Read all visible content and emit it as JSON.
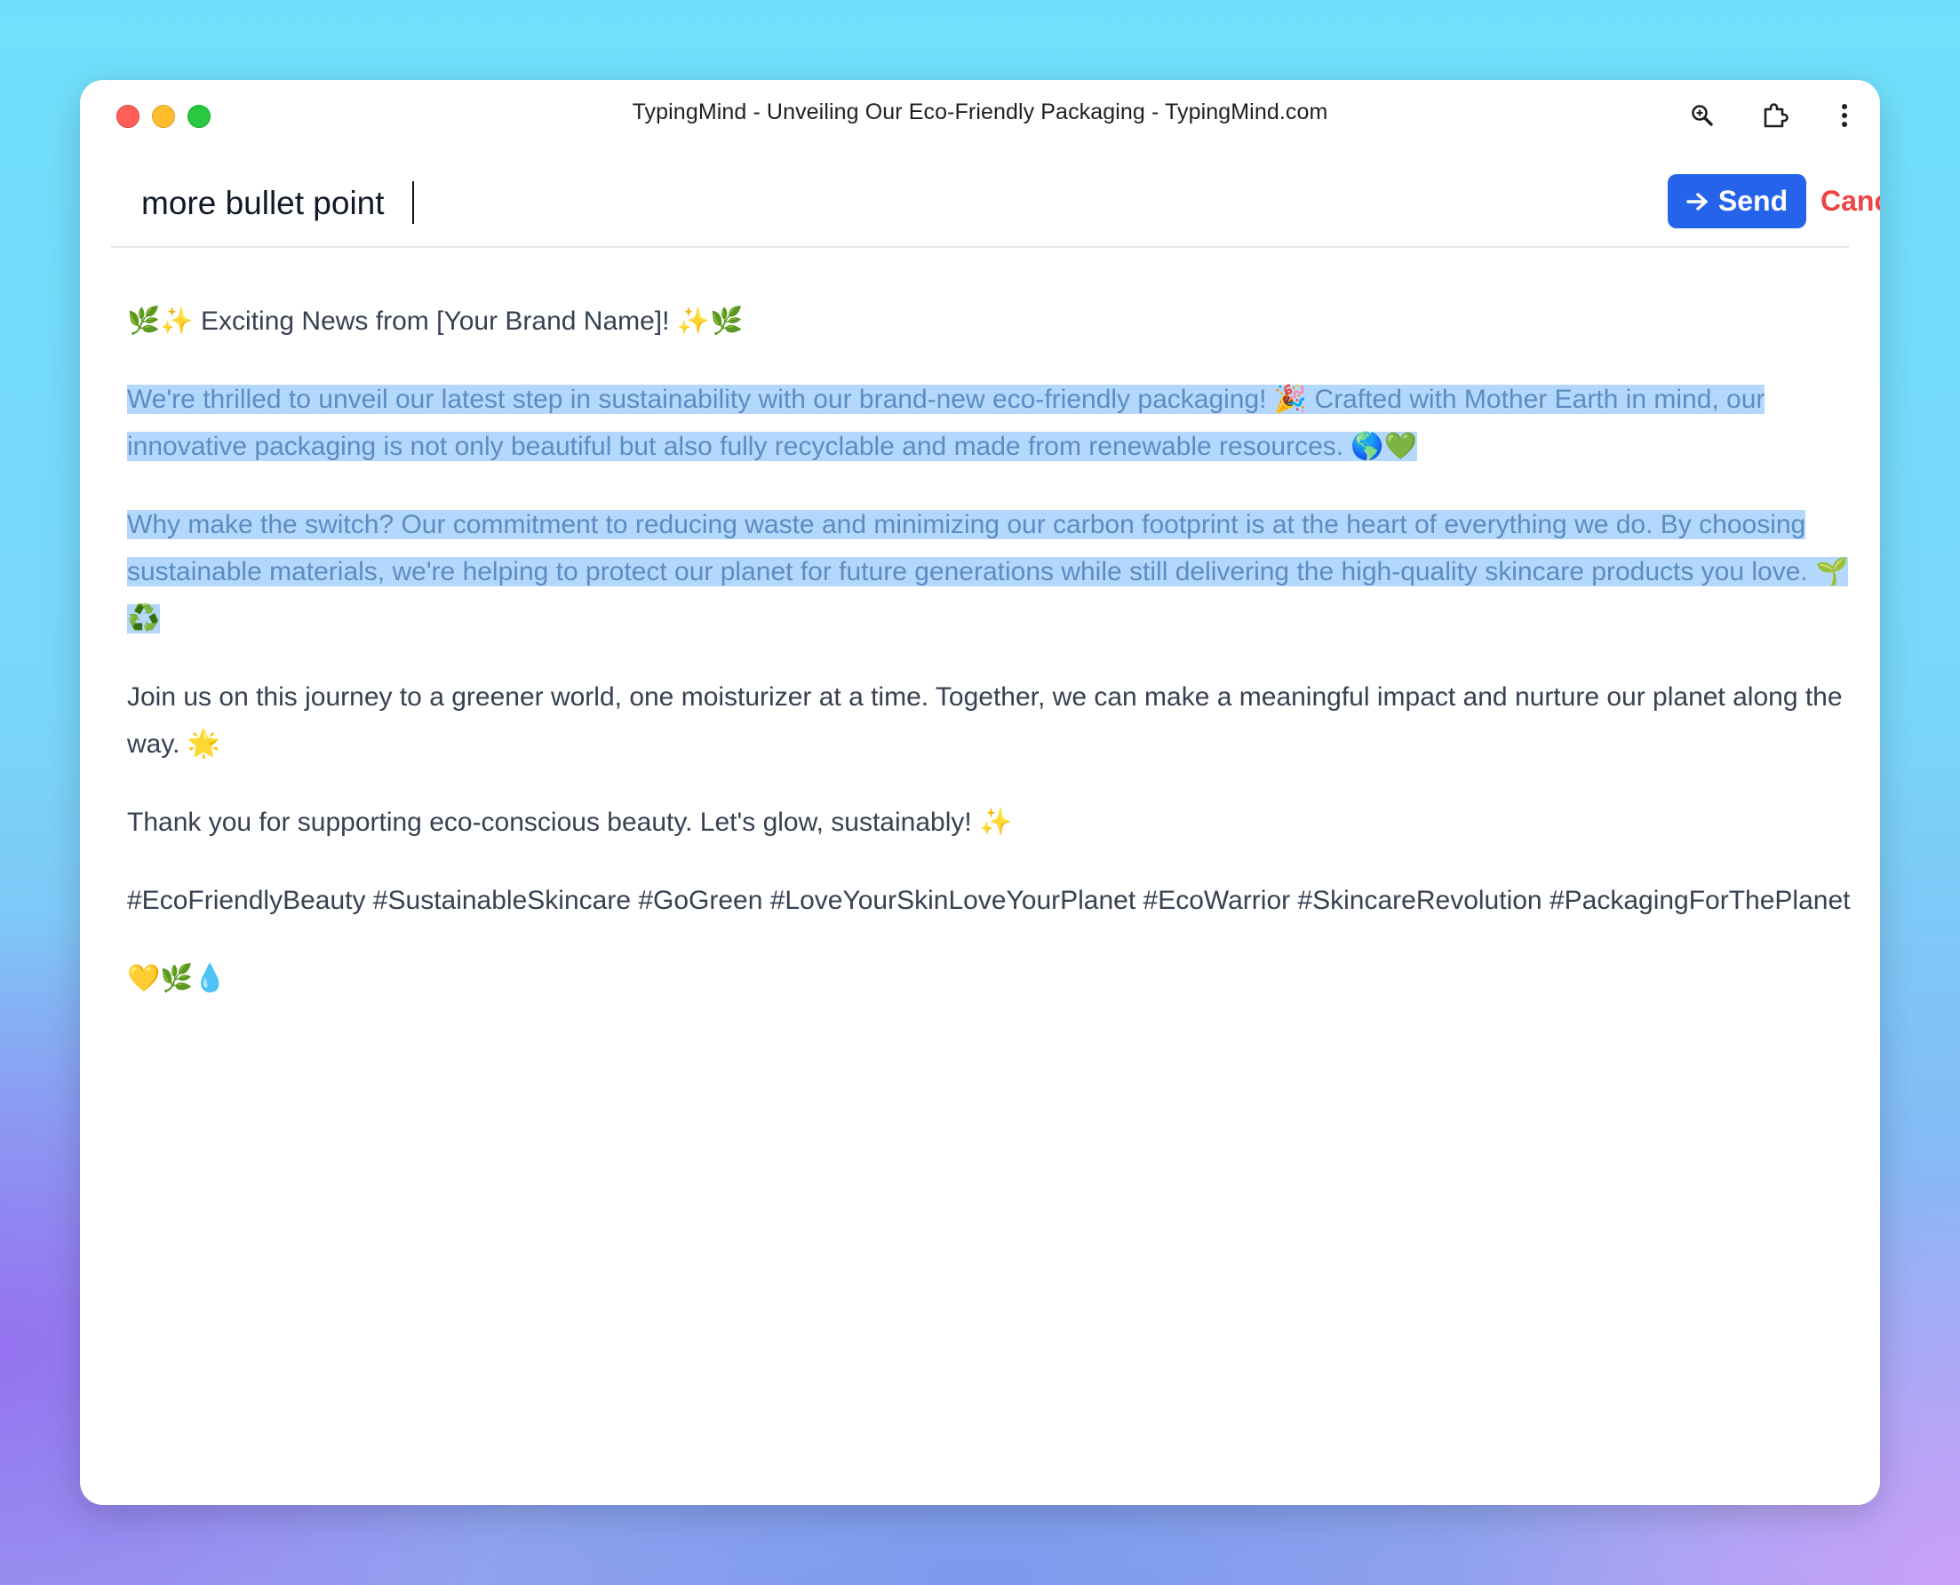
{
  "window": {
    "title": "TypingMind - Unveiling Our Eco-Friendly Packaging - TypingMind.com"
  },
  "toolbar_icons": [
    "zoom-icon",
    "extension-icon",
    "more-vertical-icon"
  ],
  "prompt": {
    "value": "more bullet point",
    "send_label": "Send",
    "cancel_label": "Cancel"
  },
  "colors": {
    "send": "#2563eb",
    "cancel": "#ef4444",
    "selection": "#b4d7fe"
  },
  "message": {
    "heading": "🌿✨ Exciting News from [Your Brand Name]! ✨🌿",
    "p1": "We're thrilled to unveil our latest step in sustainability with our brand-new eco-friendly packaging! 🎉 Crafted with Mother Earth in mind, our innovative packaging is not only beautiful but also fully recyclable and made from renewable resources. 🌎💚",
    "p2": "Why make the switch? Our commitment to reducing waste and minimizing our carbon footprint is at the heart of everything we do. By choosing sustainable materials, we're helping to protect our planet for future generations while still delivering the high-quality skincare products you love. 🌱♻️",
    "p3": "Join us on this journey to a greener world, one moisturizer at a time. Together, we can make a meaningful impact and nurture our planet along the way. 🌟",
    "p4": "Thank you for supporting eco-conscious beauty. Let's glow, sustainably! ✨",
    "hashtags": "#EcoFriendlyBeauty #SustainableSkincare #GoGreen #LoveYourSkinLoveYourPlanet #EcoWarrior #SkincareRevolution #PackagingForThePlanet",
    "closing": "💛🌿💧"
  }
}
